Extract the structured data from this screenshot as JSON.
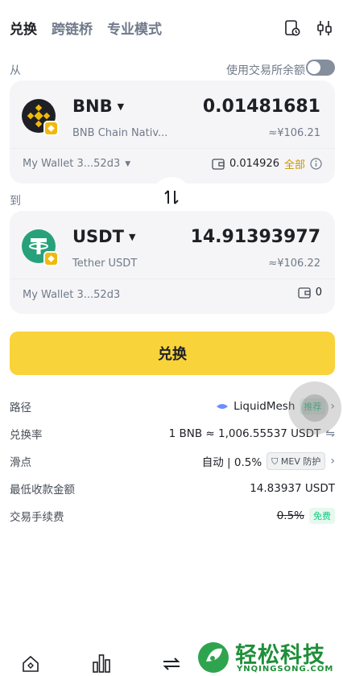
{
  "tabs": [
    "兑换",
    "跨链桥",
    "专业模式"
  ],
  "from_label": "从",
  "use_exchange_balance_label": "使用交易所余额",
  "from": {
    "symbol": "BNB",
    "chain": "BNB Chain Nativ...",
    "amount": "0.01481681",
    "fiat": "≈¥106.21",
    "wallet": "My Wallet 3...52d3",
    "balance": "0.014926",
    "all_label": "全部"
  },
  "to_label": "到",
  "to": {
    "symbol": "USDT",
    "chain": "Tether USDT",
    "amount": "14.91393977",
    "fiat": "≈¥106.22",
    "wallet": "My Wallet 3...52d3",
    "balance": "0"
  },
  "swap_button_label": "兑换",
  "details": {
    "route_label": "路径",
    "route_value": "LiquidMesh",
    "route_tag": "推荐",
    "rate_label": "兑换率",
    "rate_value": "1 BNB ≈ 1,006.55537 USDT",
    "slippage_label": "滑点",
    "slippage_value": "自动 | 0.5%",
    "mev_tag": "MEV 防护",
    "min_receive_label": "最低收款金额",
    "min_receive_value": "14.83937 USDT",
    "fee_label": "交易手续费",
    "fee_value": "0.5%",
    "fee_tag": "免费"
  },
  "watermark": {
    "title": "轻松科技",
    "url": "YNQINGSONG.COM"
  },
  "colors": {
    "accent": "#f8d33a",
    "free_green": "#0ecb81",
    "link_gold": "#c99400"
  }
}
